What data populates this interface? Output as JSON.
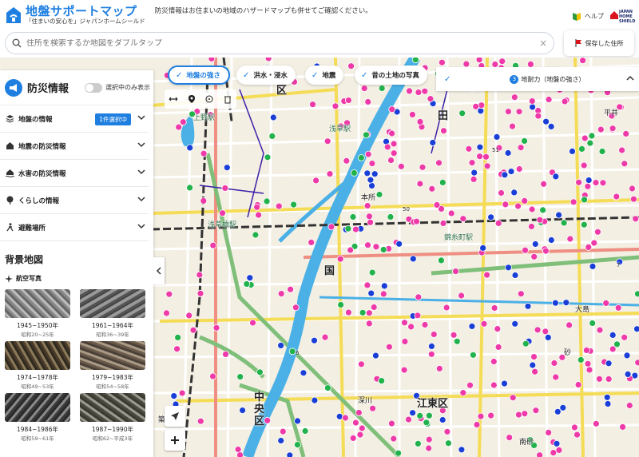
{
  "header": {
    "logo_title": "地盤サポートマップ",
    "logo_sub": "「住まいの安心を」ジャパンホームシールド",
    "desc": "防災情報はお住まいの地域のハザードマップも併せてご確認ください。",
    "help_label": "ヘルプ",
    "jhs_text": [
      "JAPAN",
      "HOME",
      "SHIELD"
    ]
  },
  "search": {
    "placeholder": "住所を検索するか地図をダブルタップ",
    "clear": "×",
    "saved_label": "保存した住所"
  },
  "filters": {
    "chips": [
      {
        "label": "地盤の強さ",
        "active": true
      },
      {
        "label": "洪水・浸水",
        "active": false
      },
      {
        "label": "地震",
        "active": false
      },
      {
        "label": "昔の土地の写真",
        "active": false
      }
    ],
    "legend_num": "3",
    "legend_label": "地耐力（地盤の強さ）"
  },
  "sidebar": {
    "title": "防災情報",
    "toggle_label": "選択中のみ表示",
    "items": [
      {
        "label": "地盤の情報",
        "badge": "1件選択中"
      },
      {
        "label": "地震の防災情報"
      },
      {
        "label": "水害の防災情報"
      },
      {
        "label": "くらしの情報"
      },
      {
        "label": "避難場所"
      }
    ],
    "bg_title": "背景地図",
    "aerial_label": "航空写真",
    "thumbs": [
      {
        "years": "1945~1950年",
        "era": "昭和20~25年"
      },
      {
        "years": "1961~1964年",
        "era": "昭和36~39年"
      },
      {
        "years": "1974~1978年",
        "era": "昭和49~53年"
      },
      {
        "years": "1979~1983年",
        "era": "昭和54~58年"
      },
      {
        "years": "1984~1986年",
        "era": "昭和59~61年"
      },
      {
        "years": "1987~1990年",
        "era": "昭和62~平成3年"
      }
    ]
  },
  "map_labels": {
    "ueno": "上野駅",
    "asakusa": "浅草駅",
    "ku": "区",
    "honjo": "本所",
    "kinshicho": "錦糸町駅",
    "ryogoku": "国",
    "chuo": "中央区",
    "koto": "江東区",
    "ojima": "大島",
    "fukagawa": "深川",
    "suna": "砂",
    "sumida": "田",
    "hirai": "平井",
    "minamisuna": "南砂",
    "asakusabashi": "浅草橋駅",
    "tsukiji": "築",
    "ue": "上",
    "numbers": [
      "6",
      "7",
      "50",
      "51"
    ]
  },
  "colors": {
    "accent": "#1f7fe0",
    "pink_dot": "#ee3aa8",
    "blue_dot": "#1a3fd6",
    "green_dot": "#22b24c",
    "river": "#4ab0e6"
  }
}
